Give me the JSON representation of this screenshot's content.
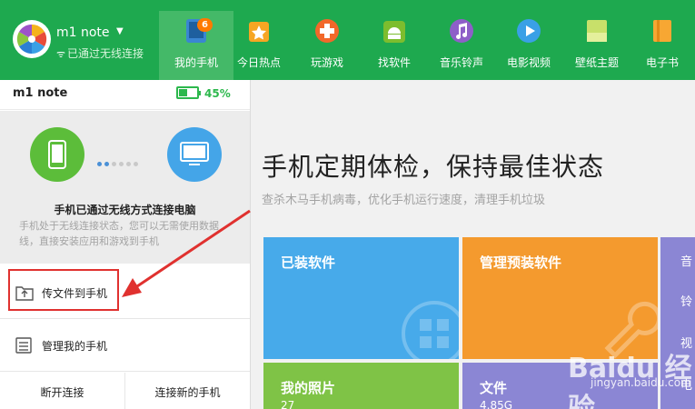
{
  "device": {
    "name": "m1 note",
    "status": "已通过无线连接",
    "battery_percent": 45,
    "battery_text": "45%"
  },
  "tabs": [
    {
      "label": "我的手机",
      "icon": "phone-icon",
      "badge": "6",
      "active": true
    },
    {
      "label": "今日热点",
      "icon": "star-icon"
    },
    {
      "label": "玩游戏",
      "icon": "gamepad-icon"
    },
    {
      "label": "找软件",
      "icon": "android-icon"
    },
    {
      "label": "音乐铃声",
      "icon": "music-icon"
    },
    {
      "label": "电影视频",
      "icon": "play-icon"
    },
    {
      "label": "壁纸主题",
      "icon": "wallpaper-icon"
    },
    {
      "label": "电子书",
      "icon": "book-icon"
    }
  ],
  "panel": {
    "title": "m1 note",
    "conn_title": "手机已通过无线方式连接电脑",
    "conn_desc": "手机处于无线连接状态，您可以无需使用数据线，直接安装应用和游戏到手机",
    "items": [
      {
        "label": "传文件到手机",
        "icon": "upload-file-icon"
      },
      {
        "label": "管理我的手机",
        "icon": "manage-phone-icon"
      }
    ],
    "disconnect_label": "断开连接",
    "connect_new_label": "连接新的手机"
  },
  "main": {
    "title": "手机定期体检，保持最佳状态",
    "subtitle": "查杀木马手机病毒，优化手机运行速度，清理手机垃圾",
    "tiles": [
      {
        "label": "已装软件",
        "color": "#47aaea"
      },
      {
        "label": "管理预装软件",
        "color": "#f49a2e"
      },
      {
        "label": "我的照片",
        "sub": "27",
        "color": "#7fc346"
      },
      {
        "label": "文件",
        "sub": "4.85G",
        "color": "#8b86d4"
      }
    ],
    "side_labels": [
      "音",
      "铃",
      "视",
      "电"
    ]
  },
  "watermark": {
    "text": "Baidu 经验",
    "url": "jingyan.baidu.com"
  },
  "colors": {
    "topbar": "#1ea94f",
    "highlight": "#e0312f",
    "battery": "#2db84d"
  }
}
